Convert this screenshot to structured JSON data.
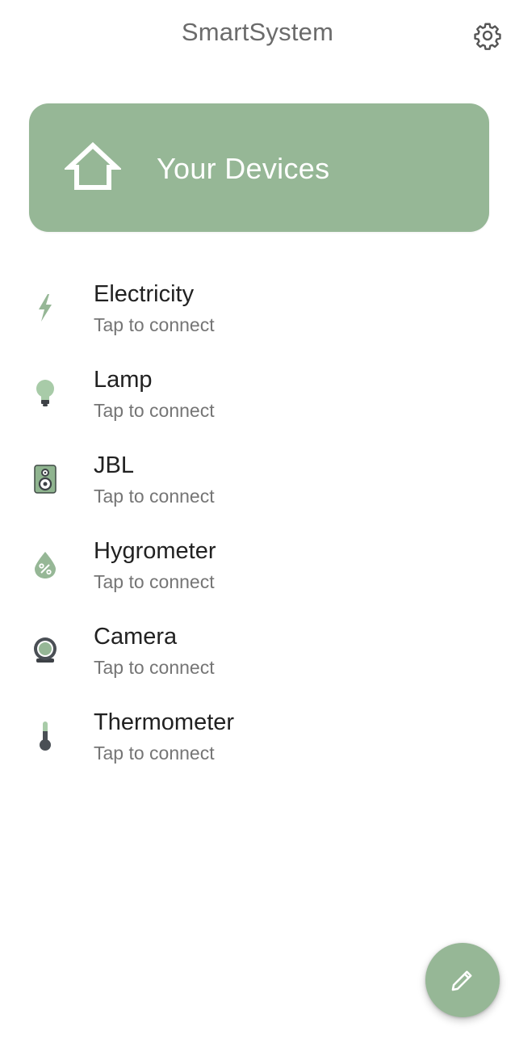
{
  "header": {
    "title": "SmartSystem",
    "settings_icon": "gear-icon"
  },
  "banner": {
    "label": "Your Devices",
    "icon": "home-icon",
    "color": "#96b796"
  },
  "devices": [
    {
      "name": "Electricity",
      "status": "Tap to connect",
      "icon": "lightning-bolt-icon"
    },
    {
      "name": "Lamp",
      "status": "Tap to connect",
      "icon": "lightbulb-icon"
    },
    {
      "name": "JBL",
      "status": "Tap to connect",
      "icon": "speaker-icon"
    },
    {
      "name": "Hygrometer",
      "status": "Tap to connect",
      "icon": "humidity-drop-icon"
    },
    {
      "name": "Camera",
      "status": "Tap to connect",
      "icon": "webcam-icon"
    },
    {
      "name": "Thermometer",
      "status": "Tap to connect",
      "icon": "thermometer-icon"
    }
  ],
  "fab": {
    "icon": "pencil-icon"
  },
  "colors": {
    "accent": "#96b796",
    "dark_icon": "#4a4f55"
  }
}
